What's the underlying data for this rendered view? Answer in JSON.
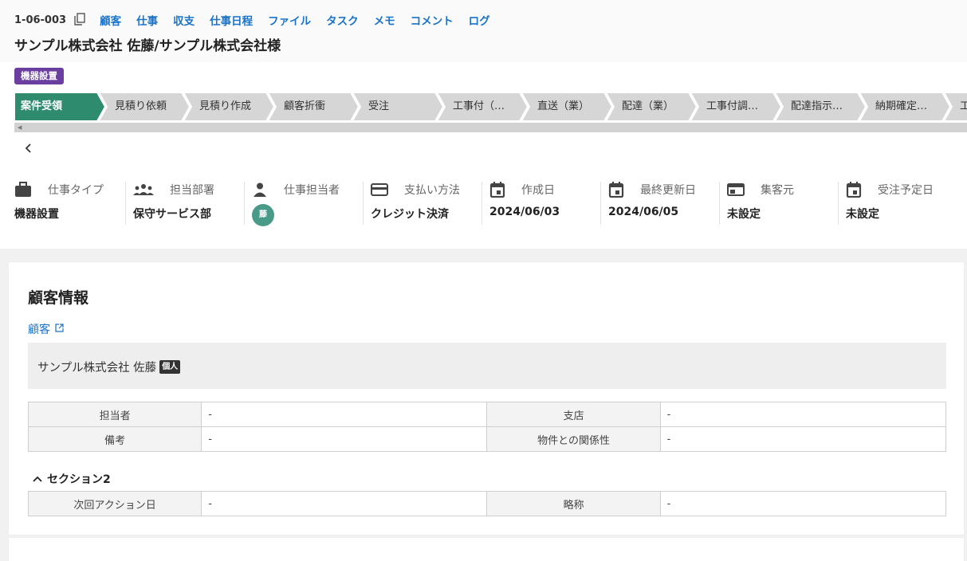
{
  "header": {
    "job_id": "1-06-003",
    "title": "サンプル株式会社 佐藤/サンプル株式会社様",
    "nav": [
      "顧客",
      "仕事",
      "収支",
      "仕事日程",
      "ファイル",
      "タスク",
      "メモ",
      "コメント",
      "ログ"
    ]
  },
  "tag": "機器設置",
  "stages": [
    "案件受領",
    "見積り依頼",
    "見積り作成",
    "顧客折衝",
    "受注",
    "工事付（…",
    "直送（業）",
    "配達（業）",
    "工事付調…",
    "配達指示…",
    "納期確定…",
    "工"
  ],
  "active_stage": 0,
  "colors": {
    "accent": "#1a73c7",
    "stage_active": "#2e8b6e",
    "stage_inactive": "#d6d6d6",
    "tag": "#6b3fa0",
    "avatar": "#4a9a8a"
  },
  "meta": [
    {
      "label": "仕事タイプ",
      "value": "機器設置",
      "icon": "briefcase-icon"
    },
    {
      "label": "担当部署",
      "value": "保守サービス部",
      "icon": "group-icon"
    },
    {
      "label": "仕事担当者",
      "value": "",
      "icon": "person-icon",
      "avatar": "藤"
    },
    {
      "label": "支払い方法",
      "value": "クレジット決済",
      "icon": "credit-card-icon"
    },
    {
      "label": "作成日",
      "value": "2024/06/03",
      "icon": "calendar-icon"
    },
    {
      "label": "最終更新日",
      "value": "2024/06/05",
      "icon": "calendar-icon"
    },
    {
      "label": "集客元",
      "value": "未設定",
      "icon": "window-icon"
    },
    {
      "label": "受注予定日",
      "value": "未設定",
      "icon": "calendar-icon"
    }
  ],
  "customer_section": {
    "title": "顧客情報",
    "link_label": "顧客",
    "customer_name": "サンプル株式会社 佐藤",
    "personal_badge": "個人",
    "rows": [
      {
        "l1": "担当者",
        "v1": "-",
        "l2": "支店",
        "v2": "-"
      },
      {
        "l1": "備考",
        "v1": "-",
        "l2": "物件との関係性",
        "v2": "-"
      }
    ],
    "section2_title": "セクション2",
    "section2_rows": [
      {
        "l1": "次回アクション日",
        "v1": "-",
        "l2": "略称",
        "v2": "-"
      }
    ]
  }
}
